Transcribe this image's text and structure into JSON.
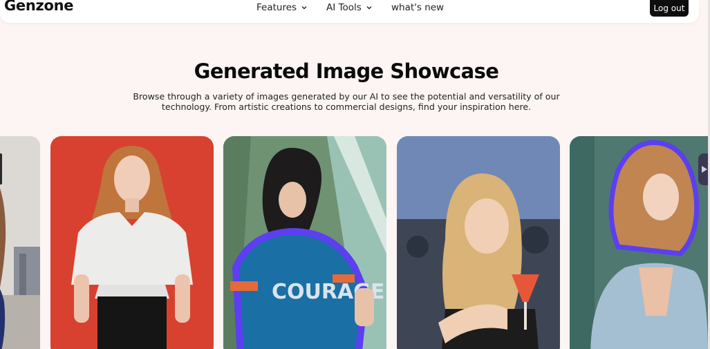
{
  "header": {
    "logo": "Genzone",
    "nav": [
      {
        "label": "Features",
        "has_dropdown": true
      },
      {
        "label": "AI Tools",
        "has_dropdown": true
      },
      {
        "label": "what's new",
        "has_dropdown": false
      }
    ],
    "logout_label": "Log out"
  },
  "main": {
    "title": "Generated Image Showcase",
    "description": "Browse through a variety of images generated by our AI to see the potential and versatility of our technology. From artistic creations to commercial designs, find your inspiration here."
  },
  "gallery": {
    "cards": [
      {
        "icon": "portrait-image",
        "background": "#d8d4cf"
      },
      {
        "icon": "portrait-image",
        "background": "#d8402e"
      },
      {
        "icon": "portrait-image",
        "background": "#6e8f70"
      },
      {
        "icon": "portrait-image",
        "background": "#6b82b1"
      },
      {
        "icon": "portrait-image",
        "background": "#4f7870"
      }
    ],
    "highlight_color": "#5b3ff0",
    "next_icon": "play-arrow-icon"
  }
}
